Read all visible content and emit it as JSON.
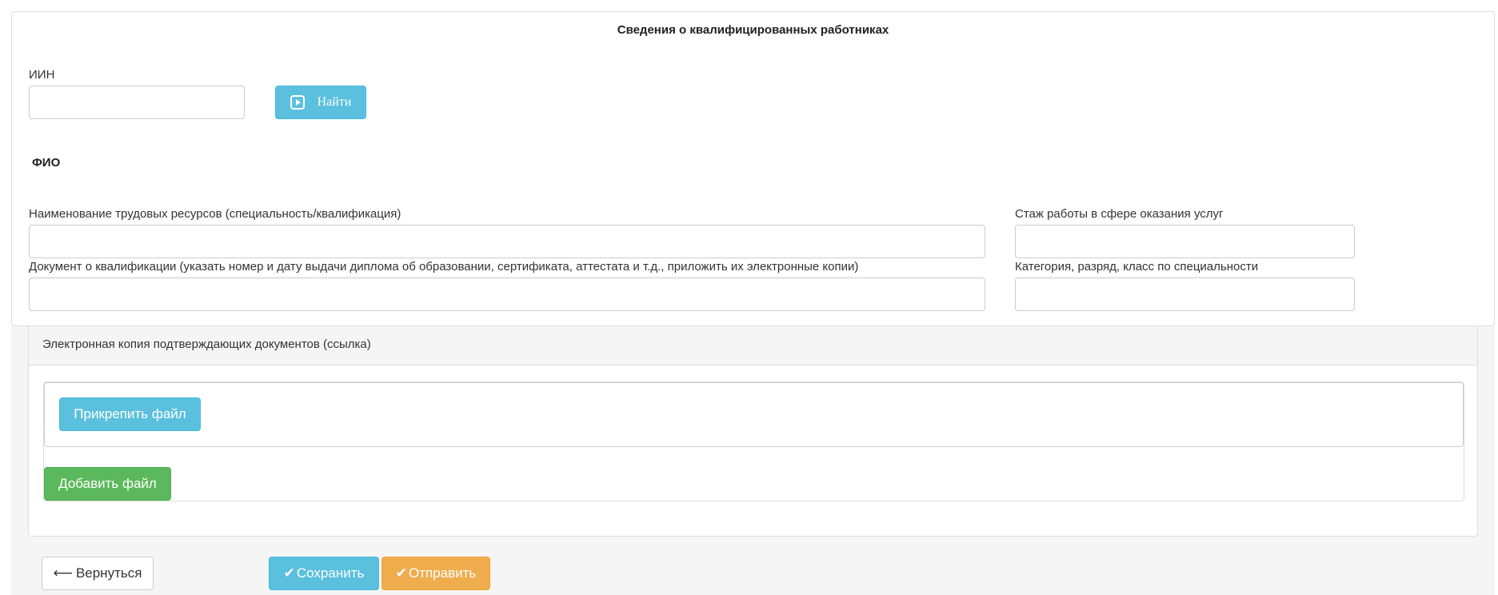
{
  "form": {
    "title": "Сведения о квалифицированных работниках",
    "iin": {
      "label": "ИИН",
      "value": ""
    },
    "find_button": {
      "label": "Найти",
      "icon": "play-square-icon"
    },
    "fio_label": "ФИО",
    "resources": {
      "label": "Наименование трудовых ресурсов (специальность/квалификация)",
      "value": ""
    },
    "experience": {
      "label": "Стаж работы в сфере оказания услуг",
      "value": ""
    },
    "qualification_doc": {
      "label": "Документ о квалификации (указать номер и дату выдачи диплома об образовании, сертификата, аттестата и т.д., приложить их электронные копии)",
      "value": ""
    },
    "category": {
      "label": "Категория, разряд, класс по специальности",
      "value": ""
    }
  },
  "docs": {
    "heading": "Электронная копия подтверждающих документов (ссылка)",
    "attach_button": "Прикрепить файл",
    "add_button": "Добавить файл"
  },
  "actions": {
    "back": {
      "label": "Вернуться",
      "icon": "left-arrow-icon"
    },
    "save": {
      "label": "Сохранить",
      "icon": "check-icon"
    },
    "send": {
      "label": "Отправить",
      "icon": "check-icon"
    }
  },
  "colors": {
    "info": "#5bc0de",
    "success": "#5cb85c",
    "warning": "#f0ad4e"
  }
}
